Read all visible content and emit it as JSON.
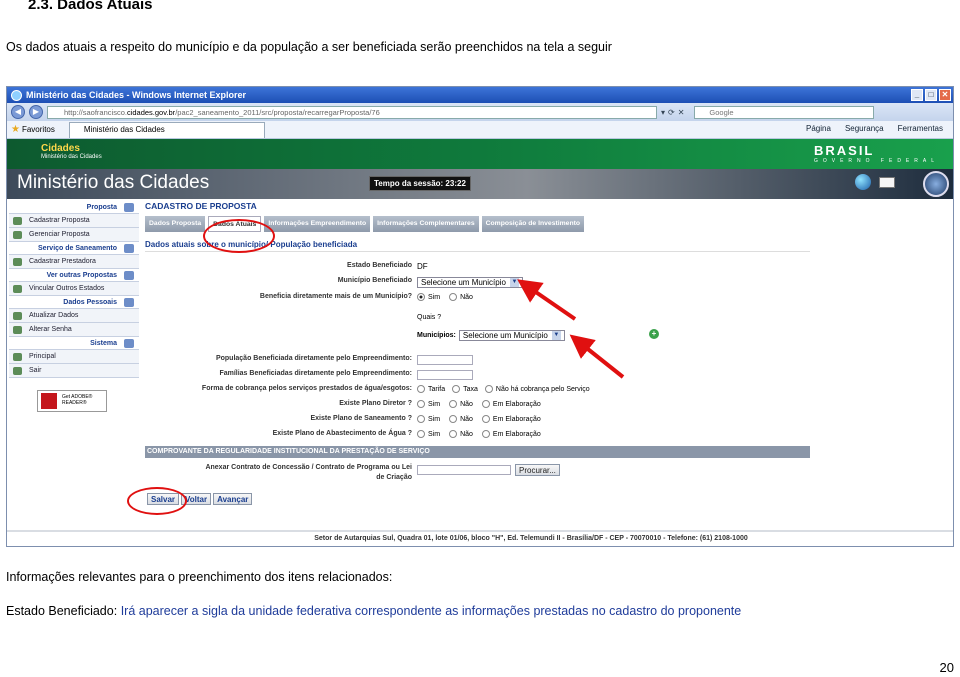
{
  "doc": {
    "heading": "2.3. Dados Atuais",
    "intro": "Os dados atuais a respeito do município e da população a ser beneficiada serão preenchidos na tela a seguir",
    "info_heading": "Informações relevantes para o preenchimento dos itens relacionados:",
    "estado_label": "Estado Beneficiado:",
    "estado_desc": "Irá aparecer a sigla da unidade federativa correspondente as informações prestadas no cadastro do proponente",
    "page_number": "20"
  },
  "browser": {
    "title": "Ministério das Cidades - Windows Internet Explorer",
    "url_prefix": "http://saofrancisco.",
    "url_domain": "cidades.gov.br",
    "url_suffix": "/pac2_saneamento_2011/src/proposta/recarregarProposta/76",
    "search_placeholder": "Google",
    "favorites": "Favoritos",
    "tab_title": "Ministério das Cidades",
    "commands": [
      "Página",
      "Segurança",
      "Ferramentas"
    ]
  },
  "site": {
    "org": "Cidades",
    "org_sub": "Ministério das Cidades",
    "brasil": "BRASIL",
    "brasil_sub": "GOVERNO FEDERAL",
    "title": "Ministério das Cidades",
    "session": "Tempo da sessão: 23:22"
  },
  "sidebar": [
    {
      "type": "head",
      "label": "Proposta"
    },
    {
      "type": "item",
      "label": "Cadastrar Proposta"
    },
    {
      "type": "item",
      "label": "Gerenciar Proposta"
    },
    {
      "type": "head",
      "label": "Serviço de Saneamento"
    },
    {
      "type": "item",
      "label": "Cadastrar Prestadora"
    },
    {
      "type": "head",
      "label": "Ver outras Propostas"
    },
    {
      "type": "item",
      "label": "Vincular Outros Estados"
    },
    {
      "type": "head",
      "label": "Dados Pessoais"
    },
    {
      "type": "item",
      "label": "Atualizar Dados"
    },
    {
      "type": "item",
      "label": "Alterar Senha"
    },
    {
      "type": "head",
      "label": "Sistema"
    },
    {
      "type": "item",
      "label": "Principal"
    },
    {
      "type": "item",
      "label": "Sair"
    }
  ],
  "adobe": "Get ADOBE® READER®",
  "form": {
    "title": "CADASTRO DE PROPOSTA",
    "tabs": [
      "Dados Proposta",
      "Dados Atuais",
      "Informações Empreendimento",
      "Informações Complementares",
      "Composição de Investimento"
    ],
    "section": "Dados atuais sobre o município/ População beneficiada",
    "estado_label": "Estado Beneficiado",
    "estado_value": "DF",
    "municipio_label": "Município Beneficiado",
    "municipio_select": "Selecione um Município",
    "beneficia_label": "Beneficia diretamente mais de um Município?",
    "sim": "Sim",
    "nao": "Não",
    "quais": "Quais ?",
    "municipios_label": "Municípios:",
    "municipios_select": "Selecione um Município",
    "pop_label": "População Beneficiada diretamente pelo Empreendimento:",
    "fam_label": "Famílias Beneficiadas diretamente pelo Empreendimento:",
    "cobranca_label": "Forma de cobrança pelos serviços prestados de água/esgotos:",
    "cobranca_opts": [
      "Tarifa",
      "Taxa",
      "Não há cobrança pelo Serviço"
    ],
    "diretor_label": "Existe Plano Diretor ?",
    "saneamento_label": "Existe Plano de Saneamento ?",
    "abastecimento_label": "Existe Plano de Abastecimento de Água ?",
    "yn_opts": [
      "Sim",
      "Não",
      "Em Elaboração"
    ],
    "bar_title": "COMPROVANTE DA REGULARIDADE INSTITUCIONAL DA PRESTAÇÃO DE SERVIÇO",
    "anexar_label": "Anexar Contrato de Concessão / Contrato de Programa ou Lei de Criação",
    "procurar": "Procurar...",
    "salvar": "Salvar",
    "voltar": "Voltar",
    "avancar": "Avançar"
  },
  "footer": "Setor de Autarquias Sul, Quadra 01, lote 01/06, bloco \"H\", Ed. Telemundi II - Brasília/DF - CEP - 70070010 - Telefone: (61) 2108-1000",
  "colors": {
    "annotation": "#e01010",
    "link_blue": "#1a3e8f"
  }
}
